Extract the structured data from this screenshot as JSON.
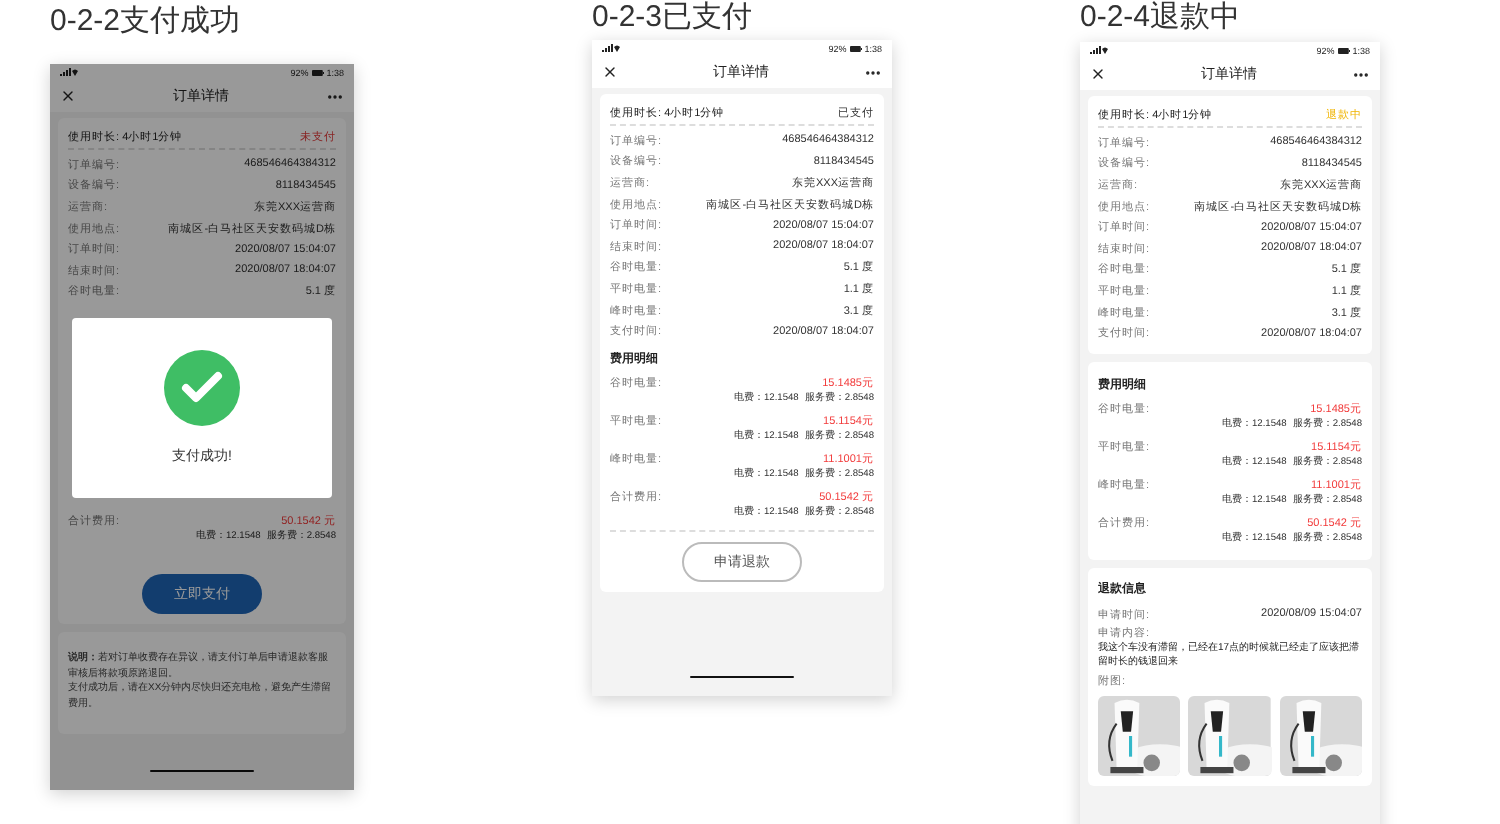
{
  "screens": [
    {
      "label": "0-2-2支付成功",
      "overlay": true,
      "status_bar": {
        "battery": "92%",
        "time": "1:38"
      },
      "title": "订单详情",
      "cards": [
        {
          "blocks": [
            {
              "kind": "summary",
              "label": "使用时长:",
              "value": "4小时1分钟",
              "status": "未支付"
            },
            {
              "kind": "details",
              "rows": [
                {
                  "label": "订单编号:",
                  "value": "468546464384312"
                },
                {
                  "label": "设备编号:",
                  "value": "8118434545"
                },
                {
                  "label": "运营商:",
                  "value": "东莞XXX运营商"
                },
                {
                  "label": "使用地点:",
                  "value": "南城区-白马社区天安数码城D栋"
                },
                {
                  "label": "订单时间:",
                  "value": "2020/08/07 15:04:07"
                },
                {
                  "label": "结束时间:",
                  "value": "2020/08/07 18:04:07"
                },
                {
                  "label": "谷时电量:",
                  "value": "5.1 度"
                }
              ]
            },
            {
              "kind": "modal",
              "message": "支付成功!"
            },
            {
              "kind": "fees",
              "items": [
                {
                  "label": "合计费用:",
                  "amount": "50.1542 元",
                  "breakdown": [
                    "电费：12.1548",
                    "服务费：2.8548"
                  ]
                }
              ]
            },
            {
              "kind": "primary",
              "label": "立即支付"
            }
          ]
        },
        {
          "blocks": [
            {
              "kind": "note",
              "paragraphs": [
                "**说明：**若对订单收费存在异议，请支付订单后申请退款客服审核后将款项原路退回。",
                "支付成功后，请在XX分钟内尽快归还充电枪，避免产生滞留费用。"
              ]
            }
          ]
        }
      ]
    },
    {
      "label": "0-2-3已支付",
      "overlay": false,
      "status_bar": {
        "battery": "92%",
        "time": "1:38"
      },
      "title": "订单详情",
      "cards": [
        {
          "blocks": [
            {
              "kind": "summary",
              "label": "使用时长:",
              "value": "4小时1分钟",
              "status": "已支付"
            },
            {
              "kind": "details",
              "rows": [
                {
                  "label": "订单编号:",
                  "value": "468546464384312"
                },
                {
                  "label": "设备编号:",
                  "value": "8118434545"
                },
                {
                  "label": "运营商:",
                  "value": "东莞XXX运营商"
                },
                {
                  "label": "使用地点:",
                  "value": "南城区-白马社区天安数码城D栋"
                },
                {
                  "label": "订单时间:",
                  "value": "2020/08/07 15:04:07"
                },
                {
                  "label": "结束时间:",
                  "value": "2020/08/07 18:04:07"
                },
                {
                  "label": "谷时电量:",
                  "value": "5.1 度"
                },
                {
                  "label": "平时电量:",
                  "value": "1.1 度"
                },
                {
                  "label": "峰时电量:",
                  "value": "3.1 度"
                },
                {
                  "label": "支付时间:",
                  "value": "2020/08/07 18:04:07"
                }
              ]
            },
            {
              "kind": "fees",
              "title": "费用明细",
              "items": [
                {
                  "label": "谷时电量:",
                  "amount": "15.1485元",
                  "breakdown": [
                    "电费：12.1548",
                    "服务费：2.8548"
                  ]
                },
                {
                  "label": "平时电量:",
                  "amount": "15.1154元",
                  "breakdown": [
                    "电费：12.1548",
                    "服务费：2.8548"
                  ]
                },
                {
                  "label": "峰时电量:",
                  "amount": "11.1001元",
                  "breakdown": [
                    "电费：12.1548",
                    "服务费：2.8548"
                  ]
                },
                {
                  "label": "合计费用:",
                  "amount": "50.1542 元",
                  "breakdown": [
                    "电费：12.1548",
                    "服务费：2.8548"
                  ]
                }
              ]
            },
            {
              "kind": "secondary",
              "label": "申请退款"
            }
          ]
        }
      ]
    },
    {
      "label": "0-2-4退款中",
      "overlay": false,
      "status_bar": {
        "battery": "92%",
        "time": "1:38"
      },
      "title": "订单详情",
      "cards": [
        {
          "blocks": [
            {
              "kind": "summary",
              "label": "使用时长:",
              "value": "4小时1分钟",
              "status": "退款中"
            },
            {
              "kind": "details",
              "rows": [
                {
                  "label": "订单编号:",
                  "value": "468546464384312"
                },
                {
                  "label": "设备编号:",
                  "value": "8118434545"
                },
                {
                  "label": "运营商:",
                  "value": "东莞XXX运营商"
                },
                {
                  "label": "使用地点:",
                  "value": "南城区-白马社区天安数码城D栋"
                },
                {
                  "label": "订单时间:",
                  "value": "2020/08/07 15:04:07"
                },
                {
                  "label": "结束时间:",
                  "value": "2020/08/07 18:04:07"
                },
                {
                  "label": "谷时电量:",
                  "value": "5.1 度"
                },
                {
                  "label": "平时电量:",
                  "value": "1.1 度"
                },
                {
                  "label": "峰时电量:",
                  "value": "3.1 度"
                },
                {
                  "label": "支付时间:",
                  "value": "2020/08/07 18:04:07"
                }
              ]
            }
          ]
        },
        {
          "blocks": [
            {
              "kind": "fees",
              "title": "费用明细",
              "items": [
                {
                  "label": "谷时电量:",
                  "amount": "15.1485元",
                  "breakdown": [
                    "电费：12.1548",
                    "服务费：2.8548"
                  ]
                },
                {
                  "label": "平时电量:",
                  "amount": "15.1154元",
                  "breakdown": [
                    "电费：12.1548",
                    "服务费：2.8548"
                  ]
                },
                {
                  "label": "峰时电量:",
                  "amount": "11.1001元",
                  "breakdown": [
                    "电费：12.1548",
                    "服务费：2.8548"
                  ]
                },
                {
                  "label": "合计费用:",
                  "amount": "50.1542 元",
                  "breakdown": [
                    "电费：12.1548",
                    "服务费：2.8548"
                  ]
                }
              ]
            }
          ]
        },
        {
          "blocks": [
            {
              "kind": "refund",
              "title": "退款信息",
              "time_label": "申请时间:",
              "time": "2020/08/09 15:04:07",
              "content_label": "申请内容:",
              "content": "我这个车没有滞留，已经在17点的时候就已经走了应该把滞留时长的钱退回来",
              "attachments_label": "附图:"
            }
          ]
        }
      ]
    }
  ]
}
